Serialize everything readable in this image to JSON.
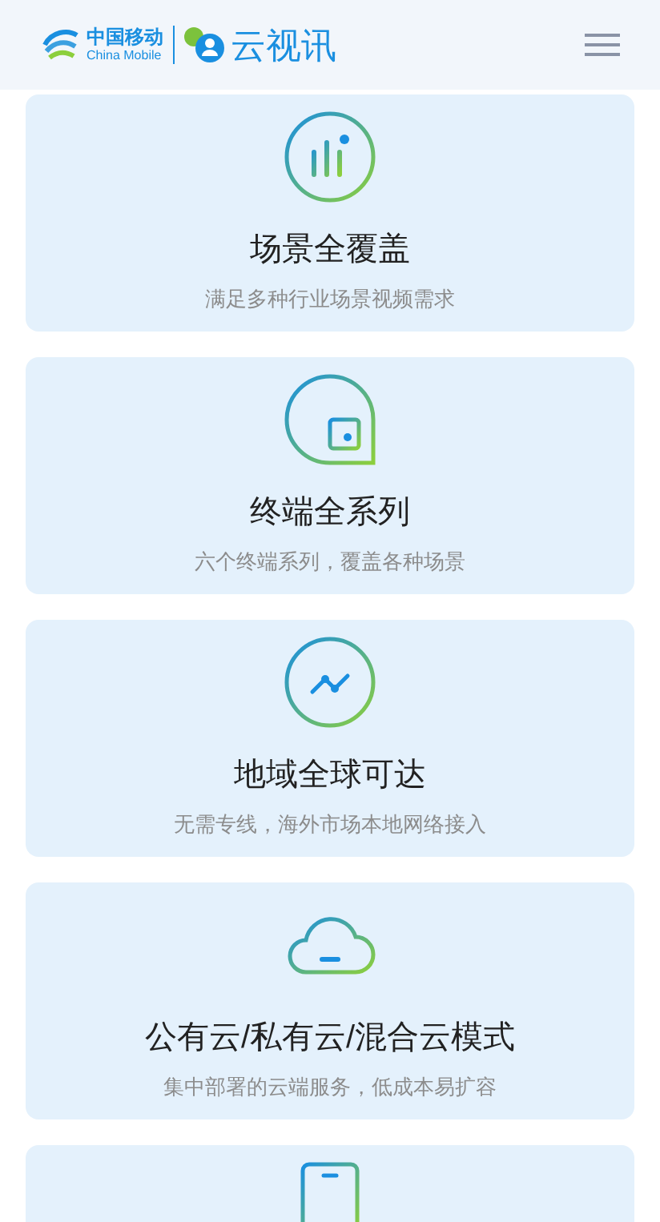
{
  "header": {
    "brand_cn": "中国移动",
    "brand_en": "China Mobile",
    "product": "云视讯"
  },
  "features": [
    {
      "kind": "bars",
      "title": "场景全覆盖",
      "subtitle": "满足多种行业场景视频需求"
    },
    {
      "kind": "square",
      "title": "终端全系列",
      "subtitle": "六个终端系列，覆盖各种场景"
    },
    {
      "kind": "route",
      "title": "地域全球可达",
      "subtitle": "无需专线，海外市场本地网络接入"
    },
    {
      "kind": "cloud",
      "title": "公有云/私有云/混合云模式",
      "subtitle": "集中部署的云端服务，低成本易扩容"
    },
    {
      "kind": "phone"
    }
  ]
}
